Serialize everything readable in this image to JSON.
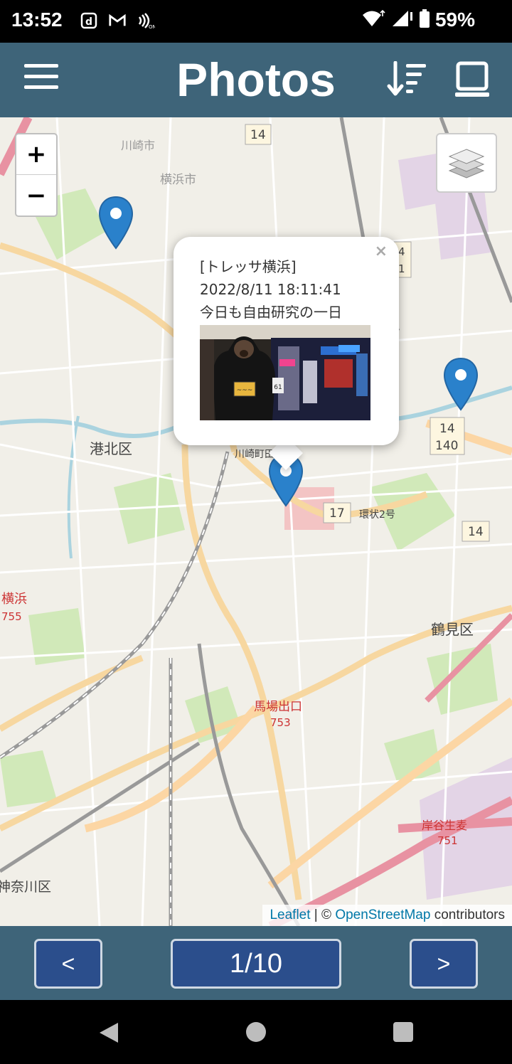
{
  "status_bar": {
    "time": "13:52",
    "left_icons": [
      "docomo-d-icon",
      "gmail-icon",
      "nfc-icon"
    ],
    "right_icons": [
      "wifi-icon",
      "signal-icon",
      "battery-icon"
    ],
    "battery_percent": "59%"
  },
  "header": {
    "title": "Photos",
    "menu_icon": "hamburger-menu-icon",
    "sort_icon": "sort-icon",
    "view_icon": "laptop-view-icon"
  },
  "map": {
    "zoom_in": "+",
    "zoom_out": "−",
    "layers_icon": "layers-icon",
    "labels": {
      "kawasaki": "川崎市",
      "yokohama": "横浜市",
      "kohoku": "港北区",
      "tsurumi": "鶴見区",
      "kanagawa": "神奈川区",
      "yokohama_station": "横浜",
      "yokohama_route": "755",
      "baba": "馬場出口",
      "baba_num": "753",
      "kishiya": "岸谷生麦",
      "kishiya_num": "751",
      "kawasaki_machida": "川崎町田",
      "kanjo2": "環状2号",
      "route14a": "14",
      "route14b": "14",
      "route140": "140",
      "route17": "17",
      "route14c": "14",
      "route14d": "4",
      "route14e": "1"
    },
    "popup": {
      "close": "×",
      "place": "[トレッサ横浜]",
      "datetime": "2022/8/11 18:11:41",
      "caption": "今日も自由研究の一日",
      "photo_sign": "61"
    },
    "attribution": {
      "leaflet": "Leaflet",
      "separator": " | © ",
      "osm": "OpenStreetMap",
      "contributors": " contributors"
    }
  },
  "pager": {
    "prev": "<",
    "count": "1/10",
    "next": ">"
  },
  "nav_bar": {
    "back_icon": "back-triangle-icon",
    "home_icon": "home-circle-icon",
    "recents_icon": "recents-square-icon"
  },
  "colors": {
    "header_bg": "#3e6479",
    "button_bg": "#2b4e8c",
    "marker": "#2a81cb",
    "leaflet_link": "#0078a8"
  }
}
